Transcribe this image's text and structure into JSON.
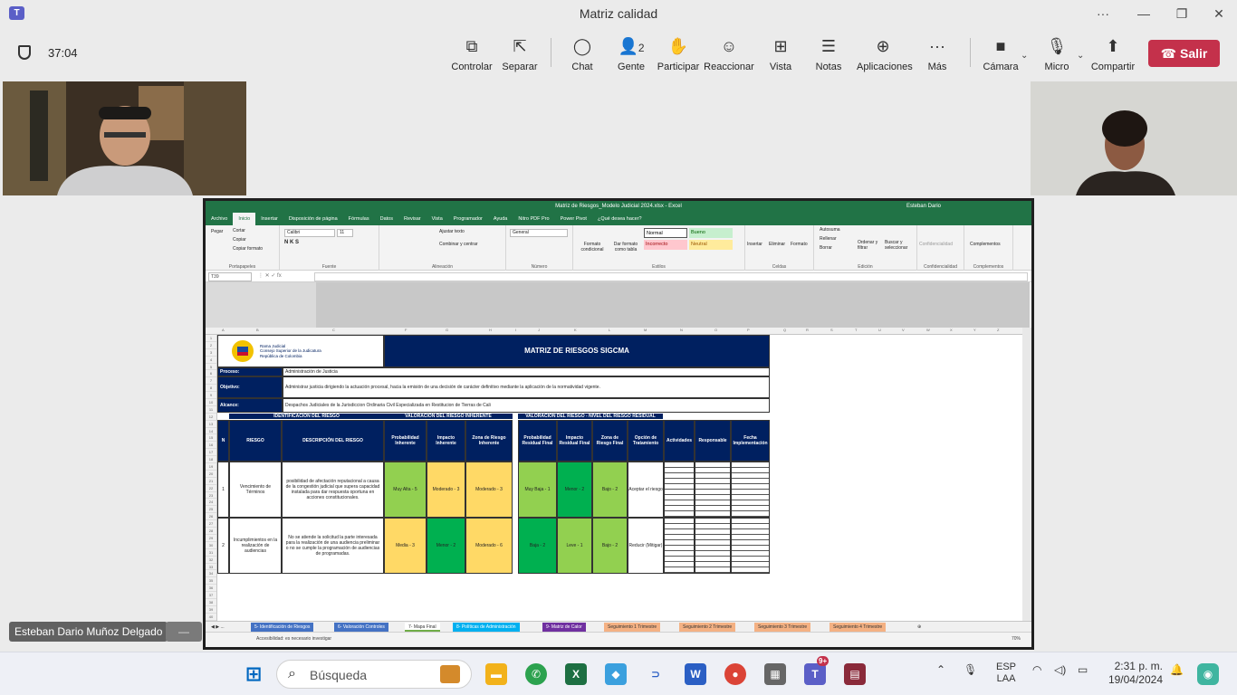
{
  "window": {
    "title": "Matriz calidad",
    "min_icon": "—",
    "max_icon": "❐",
    "close_icon": "✕",
    "more_icon": "···"
  },
  "meeting": {
    "timer": "37:04",
    "buttons": [
      {
        "label": "Controlar",
        "icon": "control-icon"
      },
      {
        "label": "Separar",
        "icon": "pop-out-icon"
      },
      {
        "label": "Chat",
        "icon": "chat-icon"
      },
      {
        "label": "Gente",
        "icon": "people-icon",
        "count": "2"
      },
      {
        "label": "Participar",
        "icon": "raise-hand-icon"
      },
      {
        "label": "Reaccionar",
        "icon": "reaction-icon"
      },
      {
        "label": "Vista",
        "icon": "grid-view-icon"
      },
      {
        "label": "Notas",
        "icon": "notes-icon"
      },
      {
        "label": "Aplicaciones",
        "icon": "apps-icon"
      },
      {
        "label": "Más",
        "icon": "more-icon"
      },
      {
        "label": "Cámara",
        "icon": "camera-icon"
      },
      {
        "label": "Micro",
        "icon": "microphone-icon"
      },
      {
        "label": "Compartir",
        "icon": "share-icon"
      }
    ],
    "leave_label": "Salir",
    "participant_name": "Esteban Dario Muñoz Delgado"
  },
  "excel": {
    "title": "Matriz de Riesgos_Modelo Judicial 2024.xlsx - Excel",
    "user": "Esteban Dario",
    "menu": [
      "Archivo",
      "Inicio",
      "Insertar",
      "Disposición de página",
      "Fórmulas",
      "Datos",
      "Revisar",
      "Vista",
      "Programador",
      "Ayuda",
      "Nitro PDF Pro",
      "Power Pivot",
      "¿Qué desea hacer?"
    ],
    "ribbon": {
      "paste": "Pegar",
      "cut": "Cortar",
      "copy": "Copiar",
      "format_painter": "Copiar formato",
      "font": "Calibri",
      "size": "11",
      "wrap": "Ajustar texto",
      "merge": "Combinar y centrar",
      "number_format": "General",
      "cond_format": "Formato condicional",
      "table_format": "Dar formato como tabla",
      "styles": [
        {
          "label": "Normal",
          "bg": "#ffffff",
          "color": "#000000"
        },
        {
          "label": "Bueno",
          "bg": "#c6efce",
          "color": "#006100"
        },
        {
          "label": "Incorrecto",
          "bg": "#ffc7ce",
          "color": "#9c0006"
        },
        {
          "label": "Neutral",
          "bg": "#ffeb9c",
          "color": "#9c5700"
        }
      ],
      "insert": "Insertar",
      "delete": "Eliminar",
      "format": "Formato",
      "autosum": "Autosuma",
      "fill": "Rellenar",
      "clear": "Borrar",
      "sort": "Ordenar y filtrar",
      "find": "Buscar y seleccionar",
      "confidentiality": "Confidencialidad",
      "addins": "Complementos",
      "groups": [
        "Portapapeles",
        "Fuente",
        "Alineación",
        "Número",
        "Estilos",
        "Celdas",
        "Edición",
        "Confidencialidad",
        "Complementos"
      ]
    },
    "name_box": "T39",
    "columns": [
      "A",
      "B",
      "C",
      "F",
      "G",
      "H",
      "I",
      "J",
      "K",
      "L",
      "M",
      "N",
      "O",
      "P",
      "Q",
      "R",
      "S",
      "T",
      "U",
      "V",
      "W",
      "X",
      "Y",
      "Z",
      "AA"
    ],
    "org": {
      "line1": "Rama Judicial",
      "line2": "Consejo Superior de la Judicatura",
      "line3": "República de Colombia"
    },
    "matrix_title": "MATRIZ DE RIESGOS SIGCMA",
    "proceso_label": "Proceso:",
    "proceso": "Administración de Justicia",
    "objetivo_label": "Objetivo:",
    "objetivo": "Administrar justicia dirigiendo la actuación procesal, hacia la emisión de una decisión de carácter definitivo mediante la aplicación de la normatividad vigente.",
    "alcance_label": "Alcance:",
    "alcance": "Despachos Judiciales de la Jurisdiccion Ordinaria Civil Especializada en Restitucion de Tierras de Cali",
    "sec_ident": "IDENTIFICACIÓN DEL RIESGO",
    "sec_inherente": "VALORACIÓN DEL RIESGO INHERENTE",
    "sec_residual": "VALORACIÓN DEL RIESGO - NIVEL DEL RIESGO RESIDUAL",
    "headers": [
      "N",
      "RIESGO",
      "DESCRIPCIÓN DEL RIESGO",
      "Probabilidad Inherente",
      "Impacto Inherente",
      "Zona de Riesgo Inherente",
      "Probabilidad Residual Final",
      "Impacto Residual Final",
      "Zona de Riesgo Final",
      "Opción de Tratamiento",
      "Actividades",
      "Responsable",
      "Fecha Implementación"
    ],
    "rows": [
      {
        "n": "1",
        "riesgo": "Vencimiento de Términos",
        "desc": "posibilidad de afectación reputacional a causa de la congestión judicial que supera capacidad instalada para dar respuesta oportuna en acciones constitucionales.",
        "prob_inh": "Muy Alta - 5",
        "imp_inh": "Moderado - 3",
        "zona_inh": "Moderado - 3",
        "prob_res": "Muy Baja - 1",
        "imp_res": "Menor - 2",
        "zona_res": "Bajo - 2",
        "opcion": "Aceptar el riesgo"
      },
      {
        "n": "2",
        "riesgo": "Incumplimientos en la realización de audiencias",
        "desc": "No se atiende la solicitud la parte interesada para la realización de una audiencia preliminar o no se cumple la programación de audiencias de programadas.",
        "prob_inh": "Media - 3",
        "imp_inh": "Menor - 2",
        "zona_inh": "Moderado - 6",
        "prob_res": "Baja - 2",
        "imp_res": "Leve - 1",
        "zona_res": "Bajo - 2",
        "opcion": "Reducir (Mitigar)"
      }
    ],
    "tabs": [
      {
        "label": "5- Identificación de Riesgos",
        "color": "#4472c4"
      },
      {
        "label": "6- Valoración Controles",
        "color": "#4472c4"
      },
      {
        "label": "7- Mapa Final",
        "color": "#70ad47"
      },
      {
        "label": "8- Políticas de Administración",
        "color": "#00b0f0"
      },
      {
        "label": "9- Matriz de Calor",
        "color": "#7030a0"
      },
      {
        "label": "Seguimiento 1 Trimestre",
        "color": "#f4b183"
      },
      {
        "label": "Seguimiento 2 Trimestre",
        "color": "#f4b183"
      },
      {
        "label": "Seguimiento 3 Trimestre",
        "color": "#f4b183"
      },
      {
        "label": "Seguimiento 4 Trimestre",
        "color": "#f4b183"
      }
    ],
    "status_text": "Accesibilidad: es necesario investigar",
    "zoom": "70%",
    "colors": {
      "red": "#ff0000",
      "yellow": "#ffd966",
      "green_dark": "#00b050",
      "green_light": "#92d050",
      "navy": "#002060"
    }
  },
  "taskbar": {
    "search_placeholder": "Búsqueda",
    "lang1": "ESP",
    "lang2": "LAA",
    "time": "2:31 p. m.",
    "date": "19/04/2024",
    "teams_badge": "9+"
  }
}
